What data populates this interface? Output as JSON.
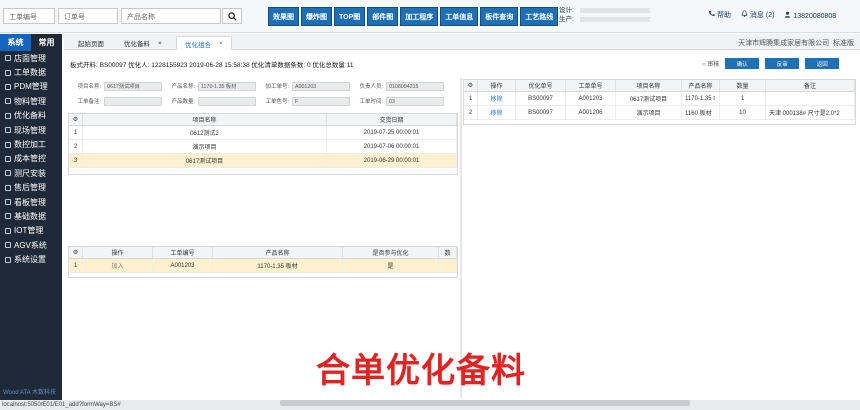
{
  "topbar": {
    "search_work_order": "工单编号",
    "search_order_no": "订单号",
    "search_product": "产品名称",
    "nav_buttons": [
      "效果图",
      "爆炸图",
      "TOP图",
      "部件图",
      "加工程序",
      "工单信息",
      "板件查询",
      "工艺路线"
    ],
    "info_design": "设计:",
    "info_produce": "生产:",
    "help": "帮助",
    "messages": "消息",
    "message_count": "(2)",
    "user": "13820080808"
  },
  "sidebar": {
    "tabs": [
      "系统",
      "常用"
    ],
    "items": [
      "店面管理",
      "工单数据",
      "PDM管理",
      "物料管理",
      "优化备料",
      "现场管理",
      "数控加工",
      "成本管控",
      "测尺安装",
      "售后管理",
      "看板管理",
      "基础数据",
      "IOT管理",
      "AGV系统",
      "系统设置"
    ],
    "logo": "Wood ATA 木数科技"
  },
  "tabs": {
    "items": [
      "起始页面",
      "优化备料",
      "优化组合"
    ],
    "company": "天津市辉腾集成家居有限公司",
    "edition": "标准版"
  },
  "header_line": "板式开料: BS00097  优化人: 1228155923  2019-06-28 15:58:38  优化清单数据条数: 0  优化总数量:11",
  "actions": {
    "ready_label": "审核",
    "buttons": [
      "确认",
      "反审",
      "返回"
    ]
  },
  "form": {
    "row1": [
      [
        "项目名称:",
        "0617测试项目"
      ],
      [
        "产品名称:",
        "1170-1.35 板材"
      ],
      [
        "加工单号:",
        "A001203"
      ],
      [
        "负责人员:",
        "0108094215"
      ]
    ],
    "row2": [
      [
        "工单备注:",
        ""
      ],
      [
        "产品数量:",
        ""
      ],
      [
        "工单色号:",
        "F"
      ],
      [
        "工单时间:",
        "03"
      ]
    ]
  },
  "left_table": {
    "headers": [
      "项目名称",
      "交货日期"
    ],
    "rows": [
      {
        "no": "1",
        "name": "0612测试2",
        "date": "2019-07-25 00:00:01"
      },
      {
        "no": "2",
        "name": "演示项目",
        "date": "2019-07-06 00:00:01"
      },
      {
        "no": "3",
        "name": "0617测试项目",
        "date": "2019-06-29 00:00:01"
      }
    ]
  },
  "bottom_table": {
    "headers": [
      "操作",
      "工单编号",
      "产品名称",
      "是否参与优化",
      "数"
    ],
    "rows": [
      {
        "no": "1",
        "op": "加入",
        "order": "A001203",
        "product": "1170-1.35 板材",
        "opt": "是"
      }
    ]
  },
  "right_table": {
    "headers": [
      "操作",
      "优化单号",
      "工单单号",
      "项目名称",
      "产品名称",
      "数量",
      "备注"
    ],
    "rows": [
      {
        "no": "1",
        "op": "移除",
        "opt_no": "BS00097",
        "order": "A001203",
        "project": "0617测试项目",
        "product": "1170-1.35 t",
        "qty": "1",
        "remark": ""
      },
      {
        "no": "2",
        "op": "移除",
        "opt_no": "BS00097",
        "order": "A001206",
        "project": "演示项目",
        "product": "1160 板材",
        "qty": "10",
        "remark": "天津 000138#  尺寸是2.0*2"
      }
    ]
  },
  "caption": "合单优化备料",
  "status_url": "localhost:5050/E01/E01_add?formWay=BS#"
}
